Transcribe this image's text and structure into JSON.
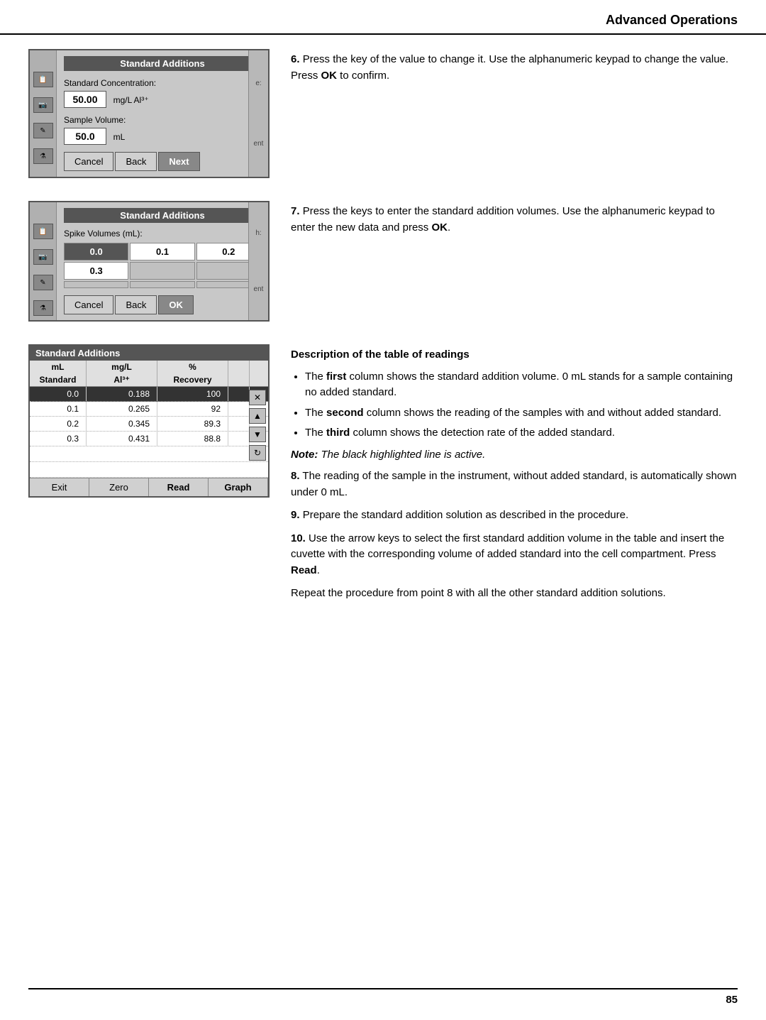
{
  "header": {
    "title": "Advanced Operations"
  },
  "section1": {
    "step": "6.",
    "text": "Press the key of the value to change it. Use the alphanumeric keypad to change the value. Press ",
    "bold": "OK",
    "text2": " to confirm.",
    "panel_title": "Standard Additions",
    "label1": "Standard Concentration:",
    "value1": "50.00",
    "unit1": "mg/L Al³⁺",
    "label2": "Sample Volume:",
    "value2": "50.0",
    "unit2": "mL",
    "btn_cancel": "Cancel",
    "btn_back": "Back",
    "btn_next": "Next",
    "right_label1": "e:",
    "right_label2": "ent"
  },
  "section2": {
    "step": "7.",
    "text": "Press the keys to enter the standard addition volumes. Use the alphanumeric keypad to enter the new data and press ",
    "bold": "OK",
    "text2": ".",
    "panel_title": "Standard Additions",
    "label1": "Spike Volumes (mL):",
    "values": [
      "0.0",
      "0.1",
      "0.2",
      "0.3",
      "",
      "",
      "",
      "",
      ""
    ],
    "btn_cancel": "Cancel",
    "btn_back": "Back",
    "btn_ok": "OK",
    "right_label1": "h:",
    "right_label2": "ent"
  },
  "section3": {
    "sa_title": "Standard Additions",
    "col_headers": [
      "mL",
      "mg/L",
      "%"
    ],
    "col_subheaders": [
      "Standard",
      "Al³⁺",
      "Recovery"
    ],
    "rows": [
      {
        "ml": "0.0",
        "mgl": "0.188",
        "pct": "100",
        "highlighted": true
      },
      {
        "ml": "0.1",
        "mgl": "0.265",
        "pct": "92",
        "highlighted": false
      },
      {
        "ml": "0.2",
        "mgl": "0.345",
        "pct": "89.3",
        "highlighted": false
      },
      {
        "ml": "0.3",
        "mgl": "0.431",
        "pct": "88.8",
        "highlighted": false
      }
    ],
    "btn_exit": "Exit",
    "btn_zero": "Zero",
    "btn_read": "Read",
    "btn_graph": "Graph",
    "desc_heading": "Description of the table of readings",
    "bullet1_bold": "first",
    "bullet1_text": " column shows the standard addition volume. 0 mL stands for a sample containing no added standard.",
    "bullet2_bold": "second",
    "bullet2_text": " column shows the reading of the samples with and without added standard.",
    "bullet3_bold": "third",
    "bullet3_text": " column shows the detection rate of the added standard.",
    "note": "Note: The black highlighted line is active.",
    "step8": "8.",
    "text8": "The reading of the sample in the instrument, without added standard, is automatically shown under 0 mL.",
    "step9": "9.",
    "text9": "Prepare the standard addition solution as described in the procedure.",
    "step10": "10.",
    "text10_1": "Use the arrow keys to select the first standard addition volume in the table and insert the cuvette with the corresponding volume of added standard into the cell compartment. Press ",
    "text10_bold": "Read",
    "text10_2": ".",
    "repeat_text": "Repeat the procedure from point 8 with all the other standard addition solutions."
  },
  "footer": {
    "page_number": "85"
  }
}
